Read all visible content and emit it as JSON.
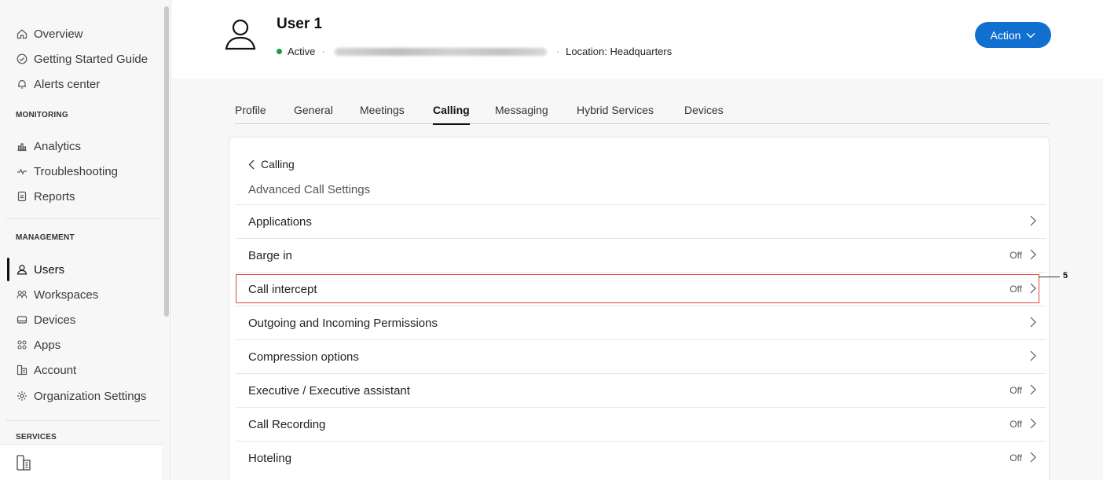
{
  "sidebar": {
    "top_items": [
      {
        "label": "Overview",
        "icon": "home-icon"
      },
      {
        "label": "Getting Started Guide",
        "icon": "check-circle-icon"
      },
      {
        "label": "Alerts center",
        "icon": "bell-icon"
      }
    ],
    "monitoring_label": "MONITORING",
    "monitoring_items": [
      {
        "label": "Analytics",
        "icon": "bar-chart-icon"
      },
      {
        "label": "Troubleshooting",
        "icon": "pulse-icon"
      },
      {
        "label": "Reports",
        "icon": "document-icon"
      }
    ],
    "management_label": "MANAGEMENT",
    "management_items": [
      {
        "label": "Users",
        "icon": "user-icon",
        "active": true
      },
      {
        "label": "Workspaces",
        "icon": "people-icon"
      },
      {
        "label": "Devices",
        "icon": "device-icon"
      },
      {
        "label": "Apps",
        "icon": "apps-grid-icon"
      },
      {
        "label": "Account",
        "icon": "building-icon"
      },
      {
        "label": "Organization Settings",
        "icon": "gear-icon"
      }
    ],
    "services_label": "SERVICES"
  },
  "header": {
    "user_name": "User 1",
    "status": "Active",
    "location": "Location: Headquarters",
    "action_label": "Action"
  },
  "tabs": [
    "Profile",
    "General",
    "Meetings",
    "Calling",
    "Messaging",
    "Hybrid Services",
    "Devices"
  ],
  "active_tab": "Calling",
  "card": {
    "back_label": "Calling",
    "subtitle": "Advanced Call Settings",
    "rows": [
      {
        "label": "Applications",
        "value": ""
      },
      {
        "label": "Barge in",
        "value": "Off"
      },
      {
        "label": "Call intercept",
        "value": "Off"
      },
      {
        "label": "Outgoing and Incoming Permissions",
        "value": ""
      },
      {
        "label": "Compression options",
        "value": ""
      },
      {
        "label": "Executive / Executive assistant",
        "value": "Off"
      },
      {
        "label": "Call Recording",
        "value": "Off"
      },
      {
        "label": "Hoteling",
        "value": "Off"
      }
    ]
  },
  "callout": "5",
  "colors": {
    "accent": "#1170cf",
    "active_status": "#1d9a4c",
    "highlight": "#e0453c"
  }
}
